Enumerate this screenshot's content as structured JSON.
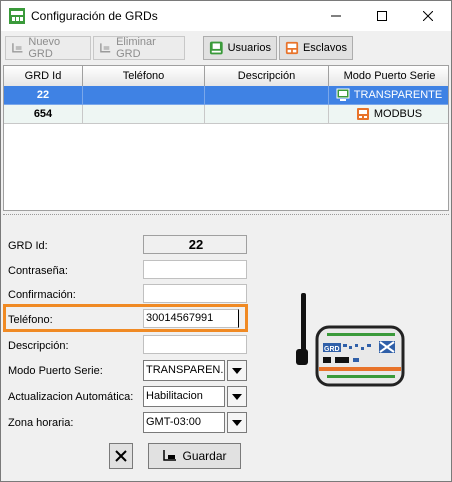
{
  "window": {
    "title": "Configuración de GRDs"
  },
  "toolbar": {
    "nuevo_grd": "Nuevo GRD",
    "eliminar_grd": "Eliminar GRD",
    "usuarios": "Usuarios",
    "esclavos": "Esclavos"
  },
  "table": {
    "columns": [
      "GRD Id",
      "Teléfono",
      "Descripción",
      "Modo Puerto Serie"
    ],
    "rows": [
      {
        "id": "22",
        "telefono": "",
        "descripcion": "",
        "modo": "TRANSPARENTE",
        "selected": true
      },
      {
        "id": "654",
        "telefono": "",
        "descripcion": "",
        "modo": "MODBUS",
        "selected": false
      }
    ]
  },
  "form": {
    "grd_id_label": "GRD Id:",
    "grd_id_value": "22",
    "contrasena_label": "Contraseña:",
    "confirmacion_label": "Confirmación:",
    "telefono_label": "Teléfono:",
    "telefono_value": "30014567991",
    "descripcion_label": "Descripción:",
    "modo_label": "Modo Puerto Serie:",
    "modo_value": "TRANSPAREN...",
    "actualizacion_label": "Actualizacion Automática:",
    "actualizacion_value": "Habilitacion",
    "zona_label": "Zona horaria:",
    "zona_value": "GMT-03:00"
  },
  "buttons": {
    "guardar": "Guardar"
  },
  "colors": {
    "selection": "#3f82e4",
    "highlight": "#f08a24",
    "accent_green": "#3a9a3a",
    "accent_orange": "#e8732a"
  },
  "icons": {
    "app": "grd-app-icon",
    "usuarios": "users-icon",
    "esclavos": "slaves-icon",
    "transparente": "monitor-green-icon",
    "modbus": "device-orange-icon",
    "device": "grd-device-illustration"
  }
}
